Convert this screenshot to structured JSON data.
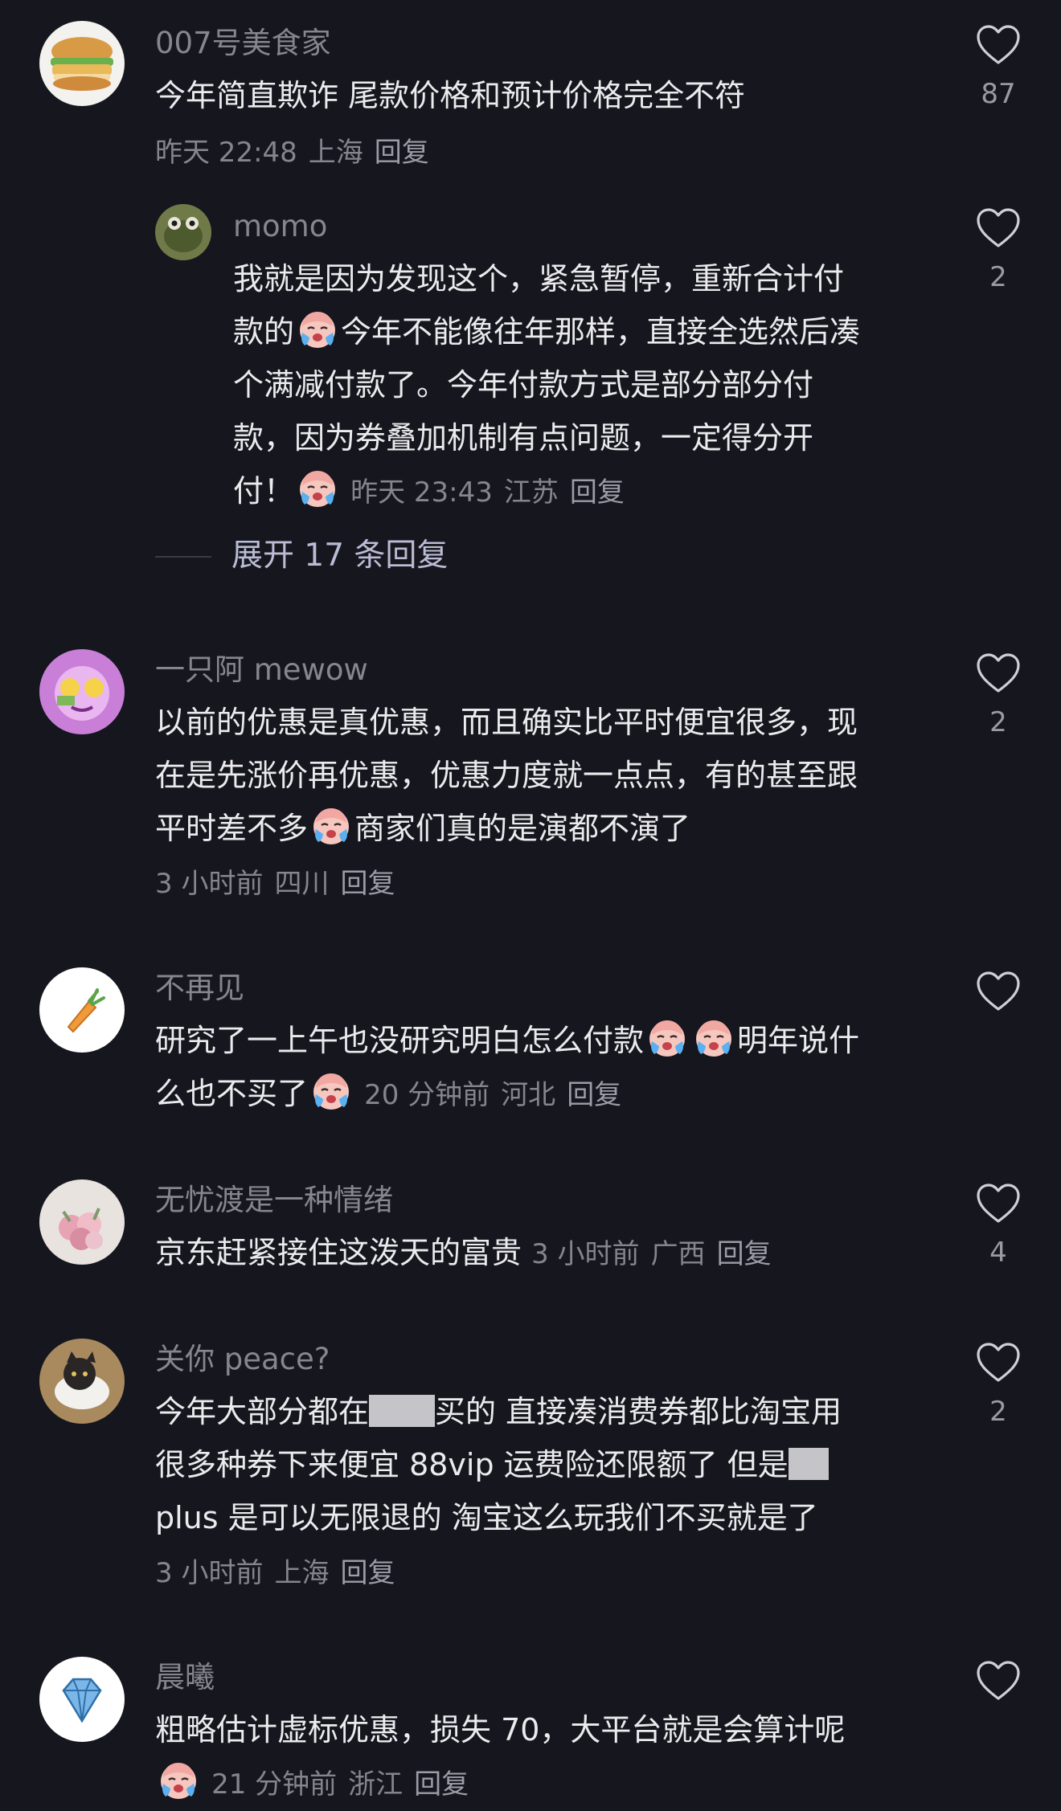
{
  "comments": [
    {
      "user": "007号美食家",
      "text": "今年简直欺诈 尾款价格和预计价格完全不符",
      "time": "昨天 22:48",
      "location": "上海",
      "reply": "回复",
      "likes": "87"
    },
    {
      "user": "momo",
      "lines": [
        "我就是因为发现这个，紧急暂停，重新合计付",
        "款的",
        "今年不能像往年那样，直接全选然后凑",
        "个满减付款了。今年付款方式是部分部分付",
        "款，因为券叠加机制有点问题，一定得分开",
        "付！"
      ],
      "time": "昨天 23:43",
      "location": "江苏",
      "reply": "回复",
      "likes": "2",
      "expand": "展开 17 条回复"
    },
    {
      "user": "一只阿 mewow",
      "lines": [
        "以前的优惠是真优惠，而且确实比平时便宜很多，现",
        "在是先涨价再优惠，优惠力度就一点点，有的甚至跟",
        "平时差不多",
        "商家们真的是演都不演了"
      ],
      "time": "3 小时前",
      "location": "四川",
      "reply": "回复",
      "likes": "2"
    },
    {
      "user": "不再见",
      "lines": [
        "研究了一上午也没研究明白怎么付款",
        "明年说什",
        "么也不买了"
      ],
      "time": "20 分钟前",
      "location": "河北",
      "reply": "回复",
      "likes": ""
    },
    {
      "user": "无忧渡是一种情绪",
      "text": "京东赶紧接住这泼天的富贵",
      "time": "3 小时前",
      "location": "广西",
      "reply": "回复",
      "likes": "4"
    },
    {
      "user": "关你 peace?",
      "lines": [
        "今年大部分都在",
        "买的 直接凑消费券都比淘宝用",
        "很多种券下来便宜 88vip 运费险还限额了 但是",
        "plus 是可以无限退的 淘宝这么玩我们不买就是了"
      ],
      "time": "3 小时前",
      "location": "上海",
      "reply": "回复",
      "likes": "2"
    },
    {
      "user": "晨曦",
      "text": "粗略估计虚标优惠，损失 70，大平台就是会算计呢",
      "time": "21 分钟前",
      "location": "浙江",
      "reply": "回复",
      "likes": ""
    }
  ]
}
